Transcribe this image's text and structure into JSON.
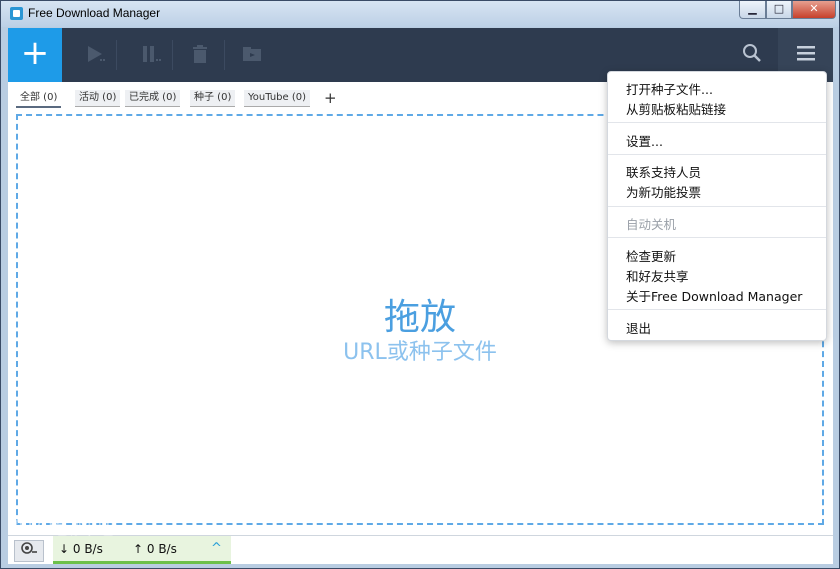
{
  "window": {
    "title": "Free Download Manager",
    "controls": {
      "minimize": "▁",
      "maximize": "□",
      "close": "✕"
    }
  },
  "toolbar": {
    "add_label": "+",
    "icons": {
      "add": "plus-icon",
      "play": "play-icon",
      "pause": "pause-icon",
      "delete": "trash-icon",
      "move": "folder-move-icon",
      "search": "search-icon",
      "menu": "hamburger-menu-icon"
    }
  },
  "tabs": [
    {
      "label": "全部 (0)"
    },
    {
      "label": "活动 (0)"
    },
    {
      "label": "已完成 (0)"
    },
    {
      "label": "种子 (0)"
    },
    {
      "label": "YouTube (0)"
    }
  ],
  "tab_add": "+",
  "dropzone": {
    "title": "拖放",
    "subtitle": "URL或种子文件"
  },
  "status": {
    "download_speed": "↓ 0 B/s",
    "upload_speed": "↑ 0 B/s",
    "toggle": "^"
  },
  "menu": {
    "items": [
      "打开种子文件...",
      "从剪贴板粘贴链接",
      "设置...",
      "联系支持人员",
      "为新功能投票",
      "自动关机",
      "检查更新",
      "和好友共享",
      "关于Free Download Manager",
      "退出"
    ]
  },
  "watermark": "AM电脑吧",
  "colors": {
    "accent": "#1e9be8",
    "toolbar": "#2e3b4f",
    "dropzone_border": "#5fa9e6",
    "speed_bar": "#6cc04a"
  }
}
